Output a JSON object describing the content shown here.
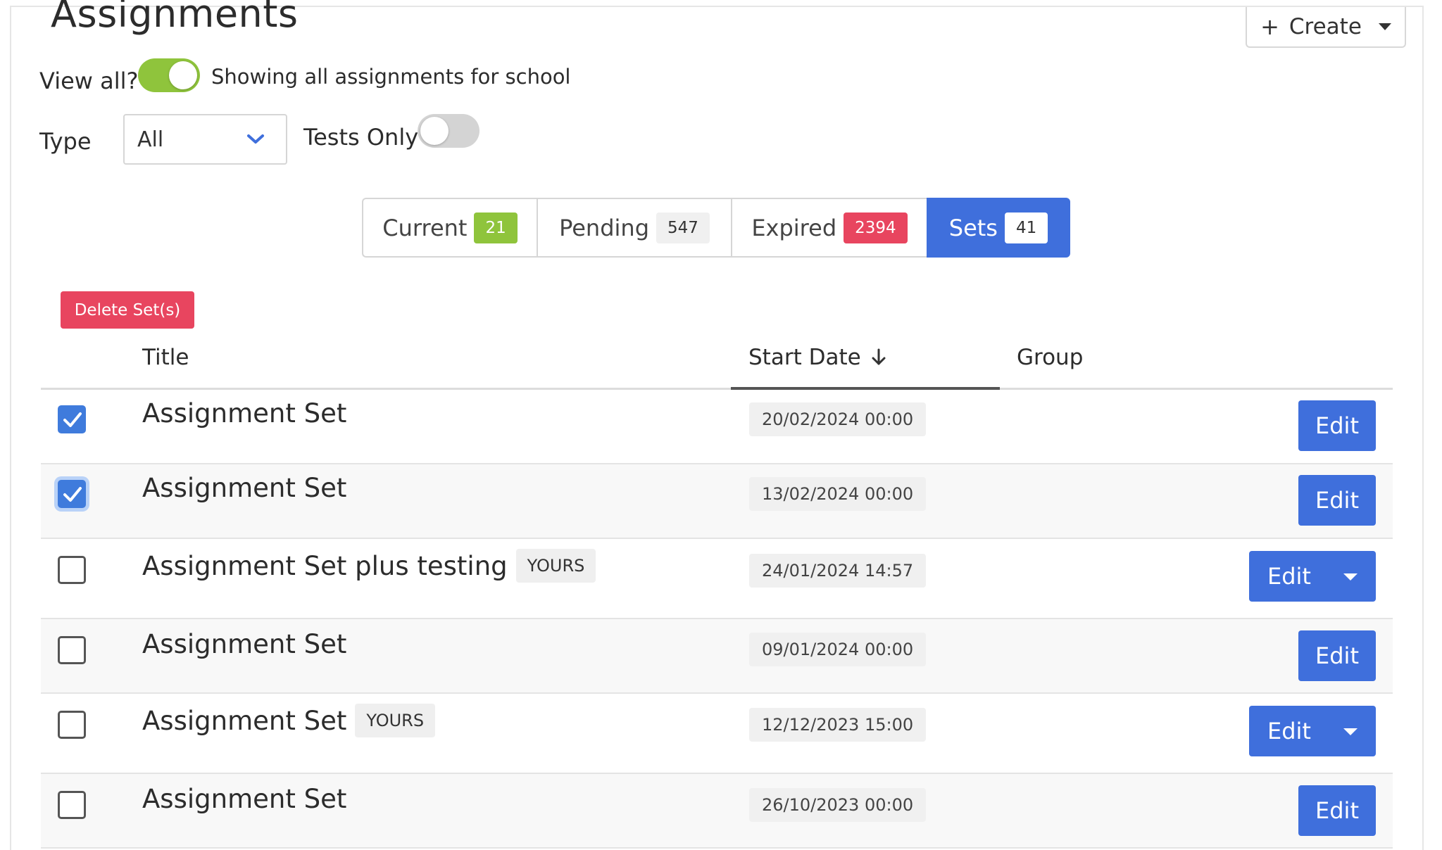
{
  "header": {
    "title": "Assignments",
    "create_label": "Create"
  },
  "filters": {
    "view_all_label": "View all?",
    "view_all_on": true,
    "view_all_desc": "Showing all assignments for school",
    "type_label": "Type",
    "type_value": "All",
    "tests_only_label": "Tests Only",
    "tests_only_on": false
  },
  "tabs": [
    {
      "label": "Current",
      "count": "21",
      "color": "#8fc43c"
    },
    {
      "label": "Pending",
      "count": "547",
      "color": "#f0f0f0"
    },
    {
      "label": "Expired",
      "count": "2394",
      "color": "#e8455f"
    },
    {
      "label": "Sets",
      "count": "41",
      "color": "#ffffff",
      "active": true
    }
  ],
  "actions": {
    "delete_label": "Delete Set(s)"
  },
  "table": {
    "headers": {
      "title": "Title",
      "start_date": "Start Date",
      "group": "Group"
    },
    "rows": [
      {
        "title": "Assignment Set",
        "date": "20/02/2024 00:00",
        "checked": true,
        "edit": "Edit"
      },
      {
        "title": "Assignment Set",
        "date": "13/02/2024 00:00",
        "checked": true,
        "edit": "Edit"
      },
      {
        "title": "Assignment Set plus testing",
        "badge": "YOURS",
        "date": "24/01/2024 14:57",
        "checked": false,
        "edit": "Edit"
      },
      {
        "title": "Assignment Set",
        "date": "09/01/2024 00:00",
        "checked": false,
        "edit": "Edit"
      },
      {
        "title": "Assignment Set",
        "badge": "YOURS",
        "date": "12/12/2023 15:00",
        "checked": false,
        "edit": "Edit"
      },
      {
        "title": "Assignment Set",
        "date": "26/10/2023 00:00",
        "checked": false,
        "edit": "Edit"
      }
    ]
  },
  "colors": {
    "accent": "#3f6fdc",
    "success": "#8fc43c",
    "danger": "#e8455f"
  }
}
